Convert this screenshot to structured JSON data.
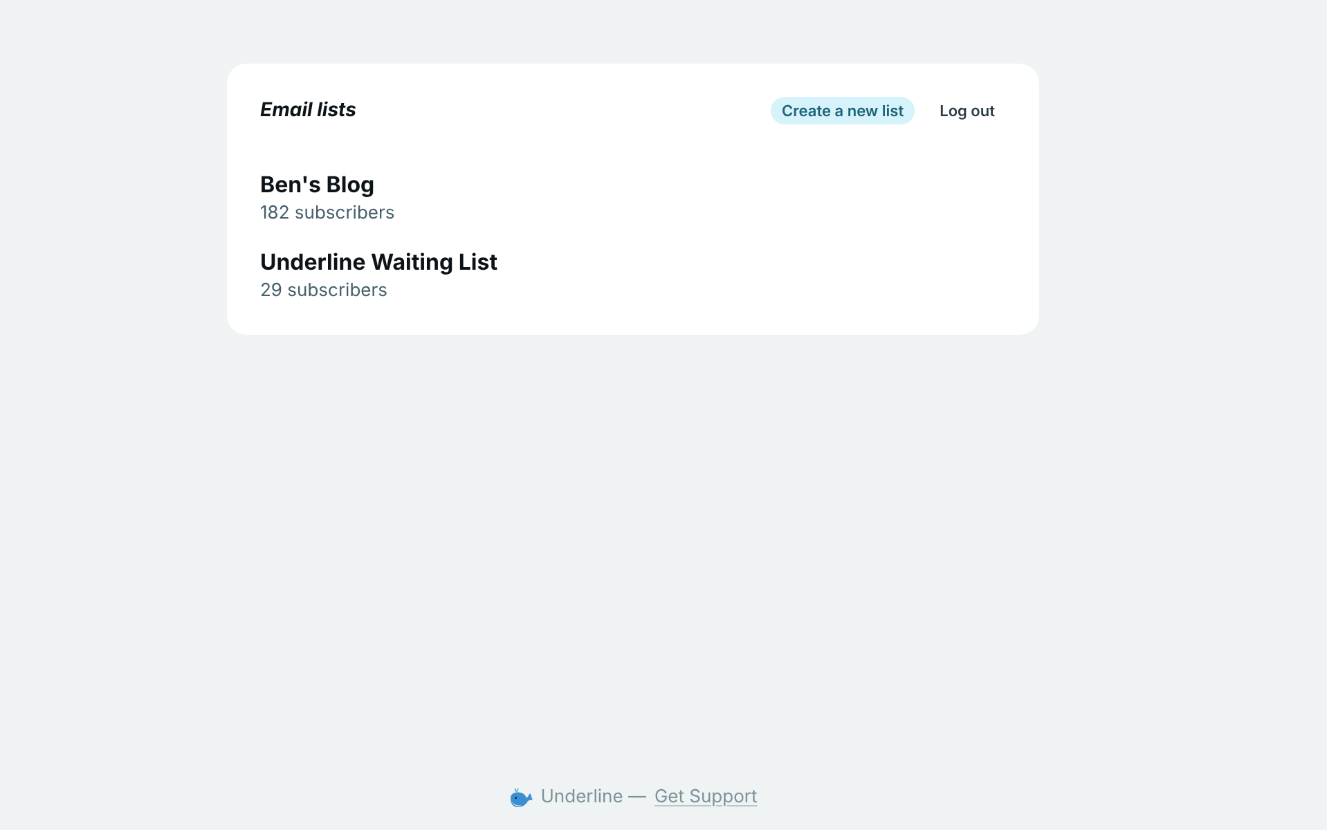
{
  "header": {
    "title": "Email lists",
    "actions": [
      {
        "kind": "primary",
        "label": "Create a new list"
      },
      {
        "kind": "plain",
        "label": "Log out"
      }
    ]
  },
  "lists": [
    {
      "name": "Ben's Blog",
      "subscribers": "182 subscribers"
    },
    {
      "name": "Underline Waiting List",
      "subscribers": "29 subscribers"
    }
  ],
  "footer": {
    "brand": "Underline —",
    "link": "Get Support"
  }
}
